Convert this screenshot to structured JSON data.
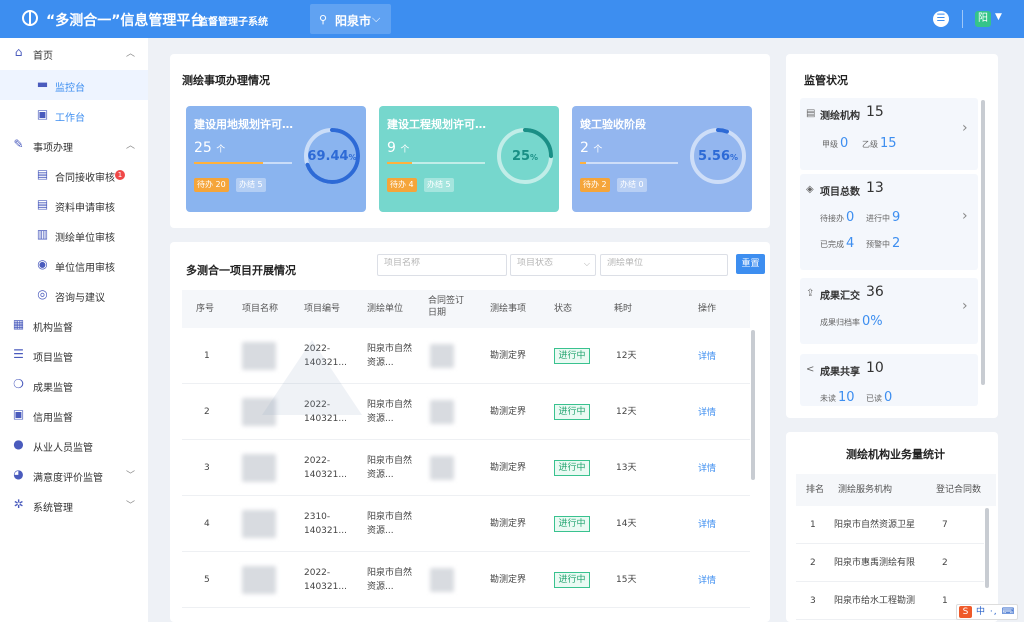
{
  "header": {
    "app_title": "“多测合一”信息管理平台",
    "subsystem": "监督管理子系统",
    "city": "阳泉市",
    "avatar_text": "阳"
  },
  "sidebar": {
    "home": "首页",
    "dashboard": "监控台",
    "workbench": "工作台",
    "affairs": "事项办理",
    "contract_review": "合同接收审核",
    "contract_badge": "1",
    "material_review": "资料申请审核",
    "unit_review": "测绘单位审核",
    "credit_review": "单位信用审核",
    "consult": "咨询与建议",
    "org_supervise": "机构监督",
    "project_supervise": "项目监管",
    "result_supervise": "成果监管",
    "credit_supervise": "信用监督",
    "staff_supervise": "从业人员监管",
    "satisfaction": "满意度评价监管",
    "system": "系统管理"
  },
  "survey_section": {
    "title": "测绘事项办理情况",
    "cards": [
      {
        "title": "建设用地规划许可…",
        "count": "25",
        "unit": "个",
        "percent": "69.44",
        "pending": "待办 20",
        "done": "办结 5",
        "progress": 0.694
      },
      {
        "title": "建设工程规划许可…",
        "count": "9",
        "unit": "个",
        "percent": "25",
        "pending": "待办 4",
        "done": "办结 5",
        "progress": 0.25
      },
      {
        "title": "竣工验收阶段",
        "count": "2",
        "unit": "个",
        "percent": "5.56",
        "pending": "待办 2",
        "done": "办结 0",
        "progress": 0.056
      }
    ],
    "percent_sign": "%"
  },
  "projects": {
    "title": "多测合一项目开展情况",
    "search_name_placeholder": "项目名称",
    "search_status_placeholder": "项目状态",
    "search_unit_placeholder": "测绘单位",
    "reset": "重置",
    "headers": [
      "序号",
      "项目名称",
      "项目编号",
      "测绘单位",
      "合同签订日期",
      "测绘事项",
      "状态",
      "耗时",
      "操作"
    ],
    "rows": [
      {
        "no": "1",
        "code": "2022-140321...",
        "unit": "阳泉市自然资源...",
        "item": "勘测定界",
        "status": "进行中",
        "time": "12天",
        "action": "详情"
      },
      {
        "no": "2",
        "code": "2022-140321...",
        "unit": "阳泉市自然资源...",
        "item": "勘测定界",
        "status": "进行中",
        "time": "12天",
        "action": "详情"
      },
      {
        "no": "3",
        "code": "2022-140321...",
        "unit": "阳泉市自然资源...",
        "item": "勘测定界",
        "status": "进行中",
        "time": "13天",
        "action": "详情"
      },
      {
        "no": "4",
        "code": "2310-140321...",
        "unit": "阳泉市自然资源...",
        "item": "勘测定界",
        "status": "进行中",
        "time": "14天",
        "action": "详情"
      },
      {
        "no": "5",
        "code": "2022-140321...",
        "unit": "阳泉市自然资源...",
        "item": "勘测定界",
        "status": "进行中",
        "time": "15天",
        "action": "详情"
      }
    ]
  },
  "monitor": {
    "title": "监管状况",
    "org": {
      "label": "测绘机构",
      "count": "15",
      "k1": "甲级",
      "v1": "0",
      "k2": "乙级",
      "v2": "15"
    },
    "projects": {
      "label": "项目总数",
      "count": "13",
      "k1": "待接办",
      "v1": "0",
      "k2": "进行中",
      "v2": "9",
      "k3": "已完成",
      "v3": "4",
      "k4": "预警中",
      "v4": "2"
    },
    "results": {
      "label": "成果汇交",
      "count": "36",
      "k1": "成果归档率",
      "v1": "0%"
    },
    "sharing": {
      "label": "成果共享",
      "count": "10",
      "k1": "未读",
      "v1": "10",
      "k2": "已读",
      "v2": "0"
    }
  },
  "ranking": {
    "title": "测绘机构业务量统计",
    "headers": [
      "排名",
      "测绘服务机构",
      "登记合同数"
    ],
    "rows": [
      {
        "rank": "1",
        "org": "阳泉市自然资源卫星",
        "num": "7"
      },
      {
        "rank": "2",
        "org": "阳泉市惠禹测绘有限",
        "num": "2"
      },
      {
        "rank": "3",
        "org": "阳泉市给水工程勘测",
        "num": "1"
      }
    ]
  },
  "ime": {
    "logo": "S",
    "text": "中 ·, ⌨"
  },
  "colors": {
    "primary": "#3d8ef0",
    "card_blue": "#8ab4ef",
    "card_teal": "#76d7cd",
    "status_green": "#22a46f",
    "pending_orange": "#f5a53a"
  }
}
